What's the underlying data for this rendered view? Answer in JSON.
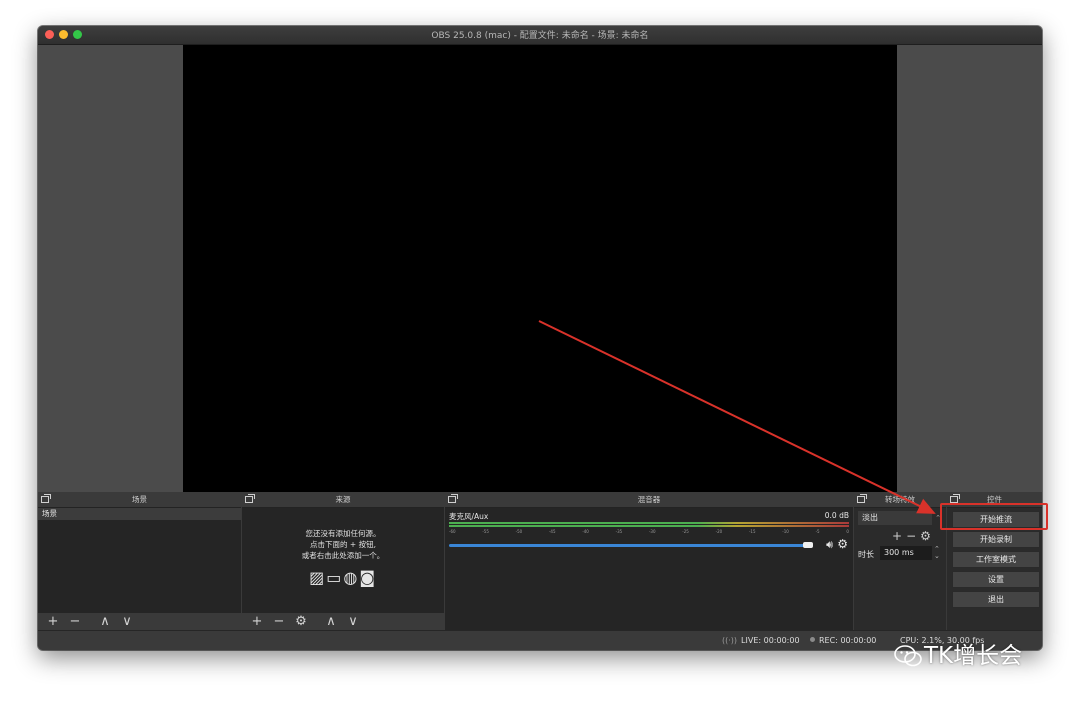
{
  "window": {
    "title": "OBS 25.0.8 (mac) - 配置文件: 未命名 - 场景: 未命名"
  },
  "docks": {
    "scenes": {
      "title": "场景",
      "items": [
        "场景"
      ]
    },
    "sources": {
      "title": "来源",
      "empty_hint": [
        "您还没有添加任何源。",
        "点击下面的 + 按钮,",
        "或者右击此处添加一个。"
      ]
    },
    "mixer": {
      "title": "混音器",
      "channel": "麦克风/Aux",
      "level": "0.0 dB",
      "ticks": [
        "-60",
        "-55",
        "-50",
        "-45",
        "-40",
        "-35",
        "-30",
        "-25",
        "-20",
        "-15",
        "-10",
        "-5",
        "0"
      ]
    },
    "transitions": {
      "title": "转场特效",
      "selected": "淡出",
      "duration_label": "时长",
      "duration_value": "300 ms"
    },
    "controls": {
      "title": "控件",
      "buttons": [
        "开始推流",
        "开始录制",
        "工作室模式",
        "设置",
        "退出"
      ]
    }
  },
  "toolbar": {
    "add": "+",
    "remove": "−",
    "up": "∧",
    "down": "∨",
    "settings": "⚙"
  },
  "status": {
    "live": "LIVE: 00:00:00",
    "rec": "REC: 00:00:00",
    "cpu": "CPU: 2.1%, 30.00 fps"
  },
  "watermark": {
    "text": "TK增长会"
  },
  "colors": {
    "highlight": "#d9322a",
    "arrow": "#d9322a",
    "volume": "#3a86d6"
  }
}
